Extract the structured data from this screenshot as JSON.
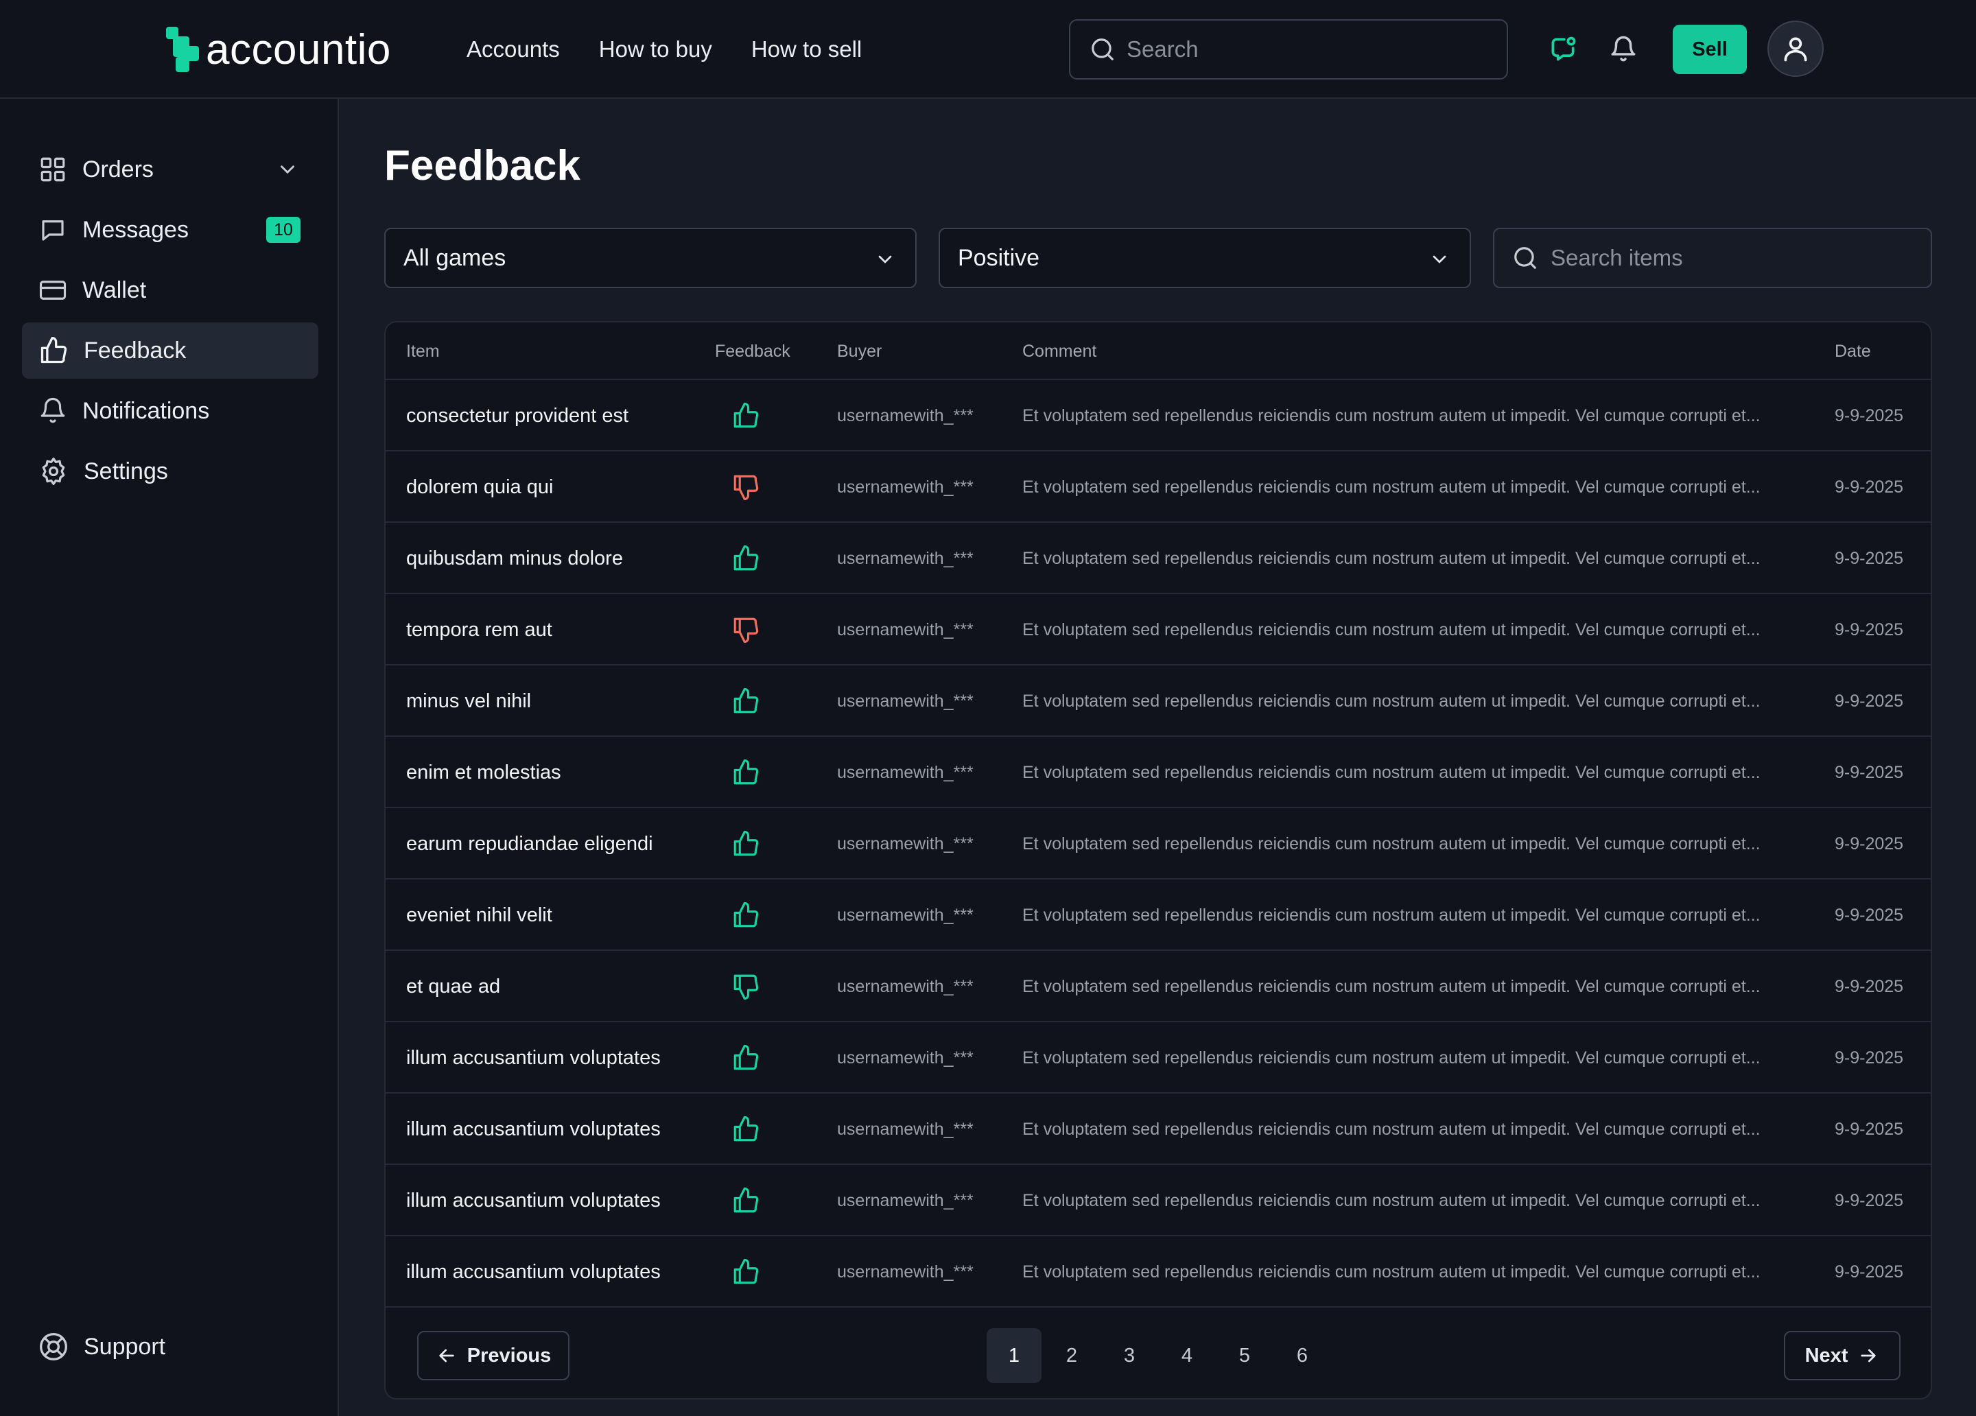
{
  "brand": {
    "name": "accountio",
    "accent": "#16d3a1"
  },
  "nav": [
    "Accounts",
    "How to buy",
    "How to sell"
  ],
  "header": {
    "search_placeholder": "Search",
    "sell_label": "Sell"
  },
  "sidebar": {
    "items": [
      {
        "label": "Orders",
        "icon": "grid-icon"
      },
      {
        "label": "Messages",
        "icon": "chat-icon",
        "badge": "10"
      },
      {
        "label": "Wallet",
        "icon": "card-icon"
      },
      {
        "label": "Feedback",
        "icon": "thumbs-up-icon",
        "active": true
      },
      {
        "label": "Notifications",
        "icon": "bell-icon"
      },
      {
        "label": "Settings",
        "icon": "gear-icon"
      }
    ],
    "support_label": "Support"
  },
  "page": {
    "title": "Feedback",
    "filters": {
      "game": "All games",
      "type": "Positive",
      "search_placeholder": "Search items"
    }
  },
  "table": {
    "columns": [
      "Item",
      "Feedback",
      "Buyer",
      "Comment",
      "Date"
    ],
    "rows": [
      {
        "item": "consectetur provident est",
        "feedback": "positive",
        "buyer": "usernamewith_***",
        "comment": "Et voluptatem sed repellendus reiciendis cum nostrum autem ut impedit. Vel cumque corrupti et...",
        "date": "9-9-2025"
      },
      {
        "item": "dolorem quia qui",
        "feedback": "negative",
        "buyer": "usernamewith_***",
        "comment": "Et voluptatem sed repellendus reiciendis cum nostrum autem ut impedit. Vel cumque corrupti et...",
        "date": "9-9-2025"
      },
      {
        "item": "quibusdam minus dolore",
        "feedback": "positive",
        "buyer": "usernamewith_***",
        "comment": "Et voluptatem sed repellendus reiciendis cum nostrum autem ut impedit. Vel cumque corrupti et...",
        "date": "9-9-2025"
      },
      {
        "item": "tempora rem aut",
        "feedback": "negative",
        "buyer": "usernamewith_***",
        "comment": "Et voluptatem sed repellendus reiciendis cum nostrum autem ut impedit. Vel cumque corrupti et...",
        "date": "9-9-2025"
      },
      {
        "item": "minus vel nihil",
        "feedback": "positive",
        "buyer": "usernamewith_***",
        "comment": "Et voluptatem sed repellendus reiciendis cum nostrum autem ut impedit. Vel cumque corrupti et...",
        "date": "9-9-2025"
      },
      {
        "item": "enim et molestias",
        "feedback": "positive",
        "buyer": "usernamewith_***",
        "comment": "Et voluptatem sed repellendus reiciendis cum nostrum autem ut impedit. Vel cumque corrupti et...",
        "date": "9-9-2025"
      },
      {
        "item": "earum repudiandae eligendi",
        "feedback": "positive",
        "buyer": "usernamewith_***",
        "comment": "Et voluptatem sed repellendus reiciendis cum nostrum autem ut impedit. Vel cumque corrupti et...",
        "date": "9-9-2025"
      },
      {
        "item": "eveniet nihil velit",
        "feedback": "positive",
        "buyer": "usernamewith_***",
        "comment": "Et voluptatem sed repellendus reiciendis cum nostrum autem ut impedit. Vel cumque corrupti et...",
        "date": "9-9-2025"
      },
      {
        "item": "et quae ad",
        "feedback": "negative-green",
        "buyer": "usernamewith_***",
        "comment": "Et voluptatem sed repellendus reiciendis cum nostrum autem ut impedit. Vel cumque corrupti et...",
        "date": "9-9-2025"
      },
      {
        "item": "illum accusantium voluptates",
        "feedback": "positive",
        "buyer": "usernamewith_***",
        "comment": "Et voluptatem sed repellendus reiciendis cum nostrum autem ut impedit. Vel cumque corrupti et...",
        "date": "9-9-2025"
      },
      {
        "item": "illum accusantium voluptates",
        "feedback": "positive",
        "buyer": "usernamewith_***",
        "comment": "Et voluptatem sed repellendus reiciendis cum nostrum autem ut impedit. Vel cumque corrupti et...",
        "date": "9-9-2025"
      },
      {
        "item": "illum accusantium voluptates",
        "feedback": "positive",
        "buyer": "usernamewith_***",
        "comment": "Et voluptatem sed repellendus reiciendis cum nostrum autem ut impedit. Vel cumque corrupti et...",
        "date": "9-9-2025"
      },
      {
        "item": "illum accusantium voluptates",
        "feedback": "positive",
        "buyer": "usernamewith_***",
        "comment": "Et voluptatem sed repellendus reiciendis cum nostrum autem ut impedit. Vel cumque corrupti et...",
        "date": "9-9-2025"
      }
    ]
  },
  "pagination": {
    "previous_label": "Previous",
    "next_label": "Next",
    "pages": [
      "1",
      "2",
      "3",
      "4",
      "5",
      "6"
    ],
    "current": "1"
  },
  "colors": {
    "positive": "#16d3a1",
    "negative": "#f26d5b"
  }
}
